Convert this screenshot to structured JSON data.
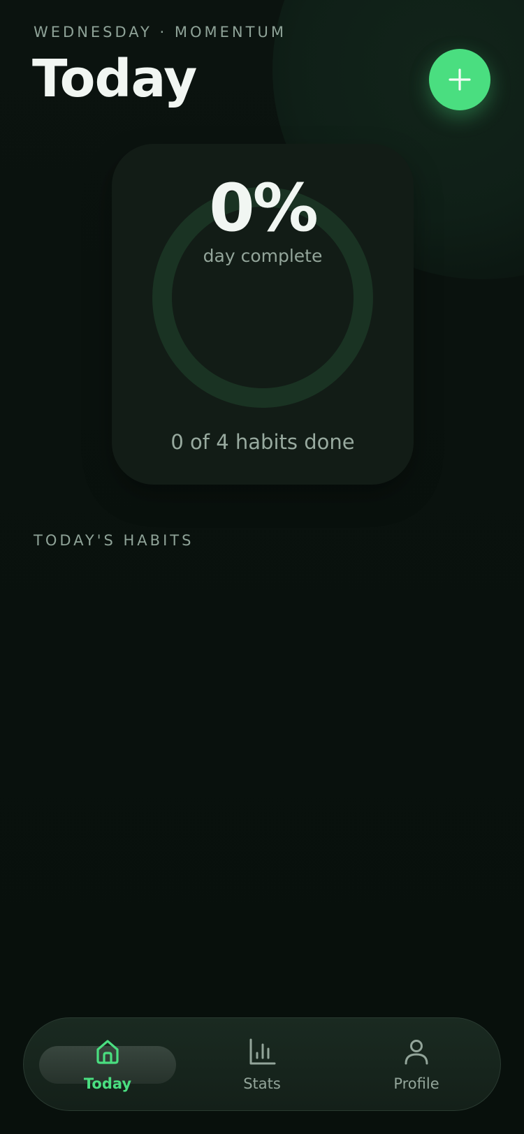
{
  "header": {
    "eyebrow": "WEDNESDAY · MOMENTUM",
    "title": "Today",
    "add_button": {
      "icon": "plus-icon"
    }
  },
  "progress": {
    "percent_text": "0%",
    "percent_value": 0,
    "label": "day complete",
    "summary": "0 of 4 habits done"
  },
  "habits_section": {
    "header": "TODAY'S HABITS",
    "items": []
  },
  "tab_bar": {
    "active": "today",
    "tabs": [
      {
        "id": "today",
        "label": "Today",
        "icon": "home-icon"
      },
      {
        "id": "stats",
        "label": "Stats",
        "icon": "bar-chart-icon"
      },
      {
        "id": "profile",
        "label": "Profile",
        "icon": "user-icon"
      }
    ]
  },
  "colors": {
    "accent": "#4ade80",
    "background": "#0a120e",
    "card": "#121c16",
    "ring_track": "#1a3323",
    "muted_text": "#8fa398"
  }
}
